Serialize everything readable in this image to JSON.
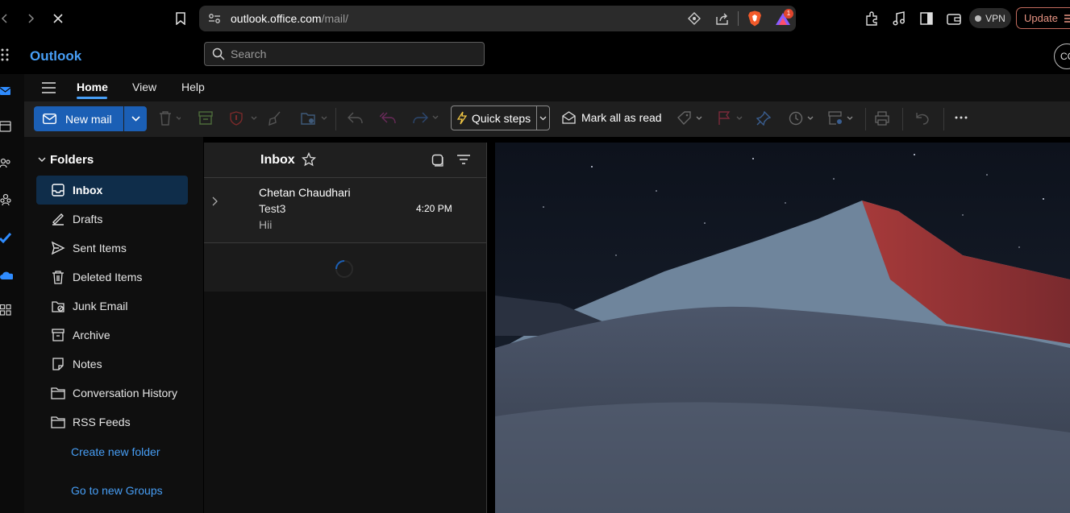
{
  "browser": {
    "url_host": "outlook.office.com",
    "url_path": "/mail/",
    "vpn_label": "VPN",
    "update_label": "Update",
    "notification_count": "1"
  },
  "app": {
    "brand": "Outlook",
    "search_placeholder": "Search",
    "avatar_initials": "CC"
  },
  "nav": {
    "tabs": [
      "Home",
      "View",
      "Help"
    ]
  },
  "ribbon": {
    "new_mail": "New mail",
    "quick_steps": "Quick steps",
    "mark_all_read": "Mark all as read"
  },
  "folders": {
    "header": "Folders",
    "items": [
      "Inbox",
      "Drafts",
      "Sent Items",
      "Deleted Items",
      "Junk Email",
      "Archive",
      "Notes",
      "Conversation History",
      "RSS Feeds"
    ],
    "create_new_folder": "Create new folder",
    "go_to_new_groups": "Go to new Groups"
  },
  "message_list": {
    "title": "Inbox",
    "messages": [
      {
        "sender": "Chetan Chaudhari",
        "subject": "Test3",
        "preview": "Hii",
        "time": "4:20 PM"
      }
    ]
  },
  "colors": {
    "accent": "#479ef5",
    "new_mail_button": "#1b5fb5",
    "selected_folder": "#0f2d4a"
  }
}
